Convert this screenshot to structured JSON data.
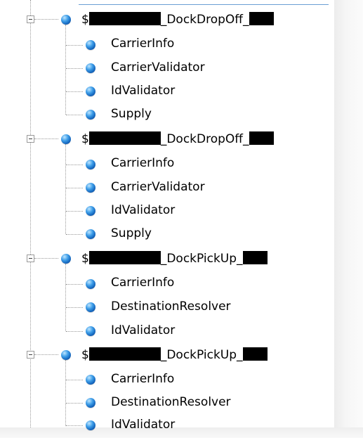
{
  "tree": {
    "groups": [
      {
        "prefix": "$",
        "suffix": "_DockDropOff_",
        "children": [
          "CarrierInfo",
          "CarrierValidator",
          "IdValidator",
          "Supply"
        ]
      },
      {
        "prefix": "$",
        "suffix": "_DockDropOff_",
        "children": [
          "CarrierInfo",
          "CarrierValidator",
          "IdValidator",
          "Supply"
        ]
      },
      {
        "prefix": "$",
        "suffix": "_DockPickUp_",
        "children": [
          "CarrierInfo",
          "DestinationResolver",
          "IdValidator"
        ]
      },
      {
        "prefix": "$",
        "suffix": "_DockPickUp_",
        "children": [
          "CarrierInfo",
          "DestinationResolver",
          "IdValidator"
        ]
      }
    ]
  },
  "colors": {
    "icon": "#2e8ae0",
    "selection_border": "#6a9fd4",
    "tree_line": "#9a9a9a"
  },
  "icons": {
    "expander": "minus-box-icon",
    "node": "blue-sphere-icon"
  }
}
